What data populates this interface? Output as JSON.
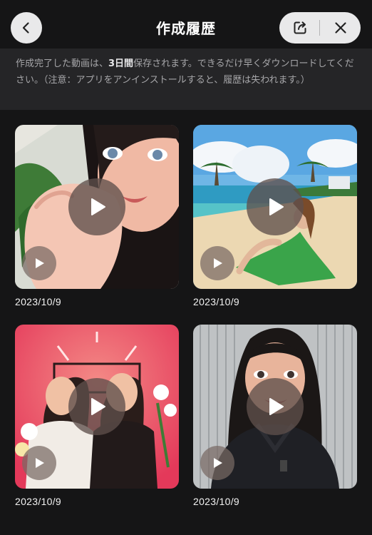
{
  "header": {
    "title": "作成履歴",
    "back_icon": "chevron-left-icon",
    "share_icon": "share-icon",
    "close_icon": "close-icon"
  },
  "notice": {
    "prefix": "作成完了した動画は、",
    "highlight": "3日間",
    "suffix": "保存されます。できるだけ早くダウンロードしてください。（注意：アプリをアンインストールすると、履歴は失われます。）"
  },
  "history": [
    {
      "date": "2023/10/9"
    },
    {
      "date": "2023/10/9"
    },
    {
      "date": "2023/10/9"
    },
    {
      "date": "2023/10/9"
    }
  ],
  "colors": {
    "background": "#151516",
    "notice_bg": "#252527",
    "button_bg": "#e9e9ea"
  }
}
